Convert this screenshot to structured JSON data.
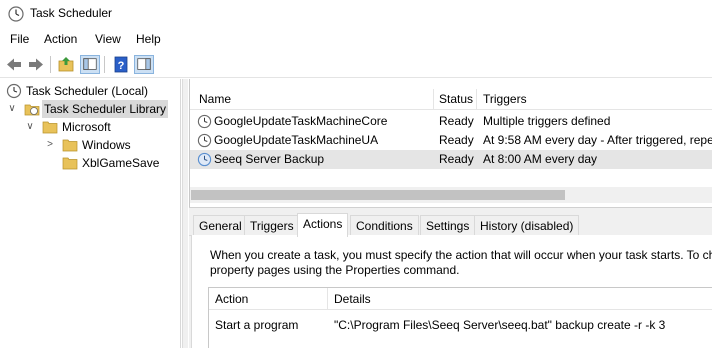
{
  "window": {
    "title": "Task Scheduler"
  },
  "menu": {
    "items": [
      "File",
      "Action",
      "View",
      "Help"
    ]
  },
  "toolbar": {
    "buttons": [
      "back-arrow-icon",
      "forward-arrow-icon",
      "up-folder-icon",
      "show-hide-console-tree-icon",
      "help-icon",
      "show-hide-action-pane-icon"
    ]
  },
  "tree": {
    "root": "Task Scheduler (Local)",
    "library": "Task Scheduler Library",
    "microsoft": "Microsoft",
    "windows": "Windows",
    "xbl": "XblGameSave"
  },
  "tasks": {
    "columns": {
      "name": "Name",
      "status": "Status",
      "triggers": "Triggers"
    },
    "rows": [
      {
        "name": "GoogleUpdateTaskMachineCore",
        "status": "Ready",
        "triggers": "Multiple triggers defined"
      },
      {
        "name": "GoogleUpdateTaskMachineUA",
        "status": "Ready",
        "triggers": "At 9:58 AM every day - After triggered, repea"
      },
      {
        "name": "Seeq Server Backup",
        "status": "Ready",
        "triggers": "At 8:00 AM every day"
      }
    ]
  },
  "detail": {
    "tabs": [
      "General",
      "Triggers",
      "Actions",
      "Conditions",
      "Settings",
      "History (disabled)"
    ],
    "active_tab": "Actions",
    "description_line1": "When you create a task, you must specify the action that will occur when your task starts.  To ch",
    "description_line2": "property pages using the Properties command.",
    "action_table": {
      "columns": {
        "action": "Action",
        "details": "Details"
      },
      "rows": [
        {
          "action": "Start a program",
          "details": "\"C:\\Program Files\\Seeq Server\\seeq.bat\" backup create -r -k 3"
        }
      ]
    }
  },
  "colors": {
    "selection": "#d9d9d9",
    "folder": "#e8c25a",
    "clock": "#5a8fd0"
  }
}
